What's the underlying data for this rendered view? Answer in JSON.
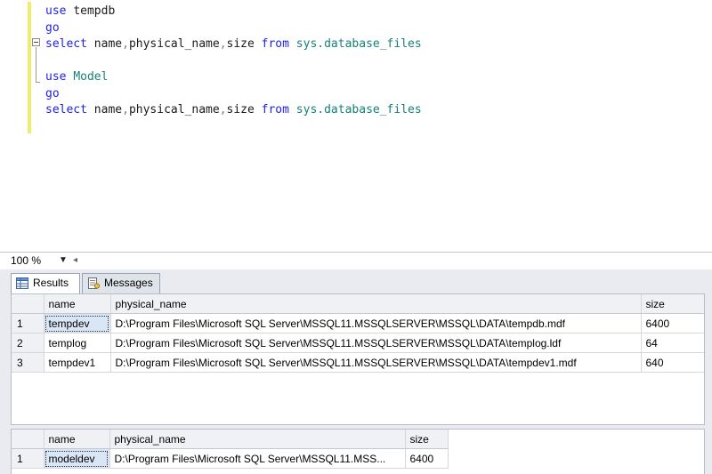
{
  "editor": {
    "lines": [
      {
        "parts": [
          {
            "t": "use ",
            "c": "kw"
          },
          {
            "t": "tempdb",
            "c": "id"
          }
        ]
      },
      {
        "parts": [
          {
            "t": "go",
            "c": "kw"
          }
        ]
      },
      {
        "parts": [
          {
            "t": "select ",
            "c": "kw"
          },
          {
            "t": "name",
            "c": "id"
          },
          {
            "t": ",",
            "c": "gray"
          },
          {
            "t": "physical_name",
            "c": "id"
          },
          {
            "t": ",",
            "c": "gray"
          },
          {
            "t": "size ",
            "c": "id"
          },
          {
            "t": "from ",
            "c": "kw"
          },
          {
            "t": "sys.database_files",
            "c": "sys"
          }
        ]
      },
      {
        "parts": []
      },
      {
        "parts": [
          {
            "t": "use ",
            "c": "kw"
          },
          {
            "t": "Model",
            "c": "sys"
          }
        ]
      },
      {
        "parts": [
          {
            "t": "go",
            "c": "kw"
          }
        ]
      },
      {
        "parts": [
          {
            "t": "select ",
            "c": "kw"
          },
          {
            "t": "name",
            "c": "id"
          },
          {
            "t": ",",
            "c": "gray"
          },
          {
            "t": "physical_name",
            "c": "id"
          },
          {
            "t": ",",
            "c": "gray"
          },
          {
            "t": "size ",
            "c": "id"
          },
          {
            "t": "from ",
            "c": "kw"
          },
          {
            "t": "sys.database_files",
            "c": "sys"
          }
        ]
      }
    ]
  },
  "zoom": {
    "value": "100 %"
  },
  "tabs": {
    "results_label": "Results",
    "messages_label": "Messages"
  },
  "grid1": {
    "columns": [
      "name",
      "physical_name",
      "size"
    ],
    "rows": [
      {
        "num": "1",
        "name": "tempdev",
        "physical_name": "D:\\Program Files\\Microsoft SQL Server\\MSSQL11.MSSQLSERVER\\MSSQL\\DATA\\tempdb.mdf",
        "size": "6400"
      },
      {
        "num": "2",
        "name": "templog",
        "physical_name": "D:\\Program Files\\Microsoft SQL Server\\MSSQL11.MSSQLSERVER\\MSSQL\\DATA\\templog.ldf",
        "size": "64"
      },
      {
        "num": "3",
        "name": "tempdev1",
        "physical_name": "D:\\Program Files\\Microsoft SQL Server\\MSSQL11.MSSQLSERVER\\MSSQL\\DATA\\tempdev1.mdf",
        "size": "640"
      }
    ]
  },
  "grid2": {
    "columns": [
      "name",
      "physical_name",
      "size"
    ],
    "rows": [
      {
        "num": "1",
        "name": "modeldev",
        "physical_name": "D:\\Program Files\\Microsoft SQL Server\\MSSQL11.MSS...",
        "size": "6400"
      }
    ]
  }
}
